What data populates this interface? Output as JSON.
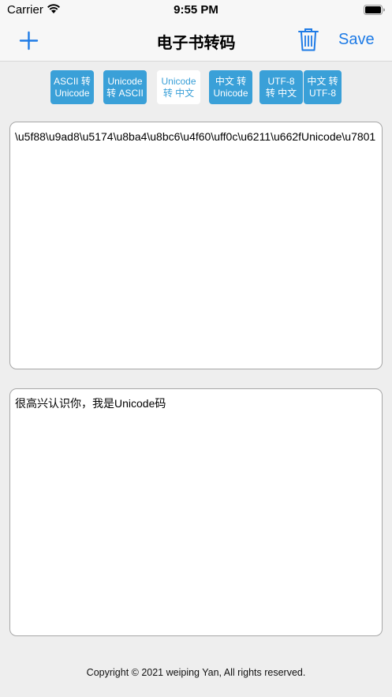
{
  "status_bar": {
    "carrier": "Carrier",
    "time": "9:55 PM"
  },
  "nav": {
    "title": "电子书转码",
    "save_label": "Save",
    "add_icon": "plus-icon",
    "delete_icon": "trash-icon"
  },
  "segments": [
    {
      "label": "ASCII 转\nUnicode",
      "active": false
    },
    {
      "label": "Unicode\n转 ASCII",
      "active": false
    },
    {
      "label": "Unicode\n转 中文",
      "active": true
    },
    {
      "label": "中文 转\nUnicode",
      "active": false
    },
    {
      "label": "UTF-8\n转 中文",
      "active": false
    },
    {
      "label": "中文 转\nUTF-8",
      "active": false
    }
  ],
  "input_text": "\\u5f88\\u9ad8\\u5174\\u8ba4\\u8bc6\\u4f60\\uff0c\\u6211\\u662fUnicode\\u7801",
  "output_text": "很高兴认识你，我是Unicode码",
  "footer": "Copyright © 2021 weiping Yan, All rights reserved.",
  "colors": {
    "accent": "#1e7be6",
    "segment": "#3aa0d8",
    "background": "#eeeeee"
  }
}
